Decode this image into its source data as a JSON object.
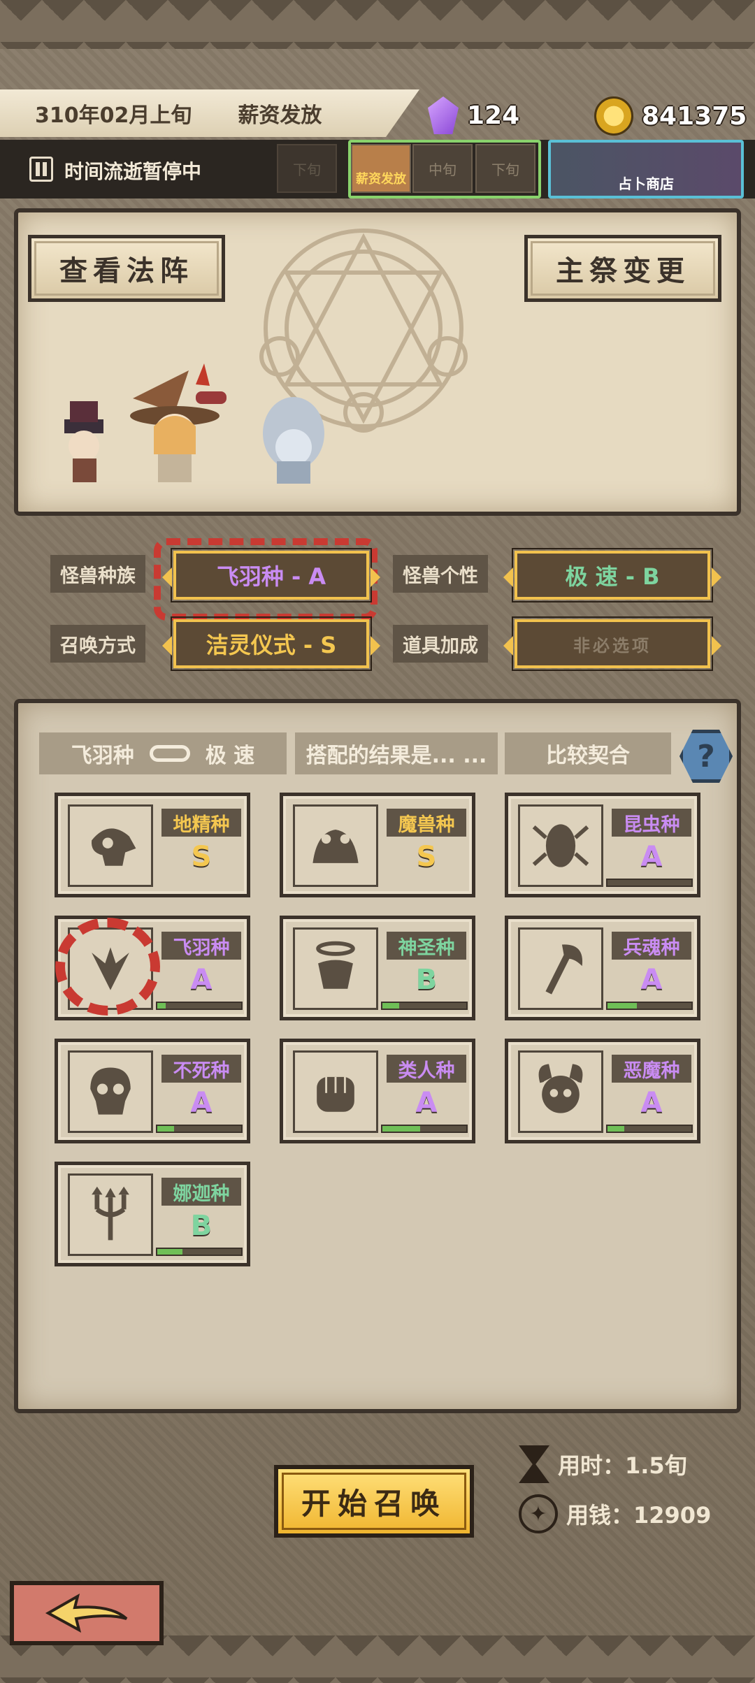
{
  "header": {
    "date": "310年02月上旬",
    "event": "薪资发放",
    "crystals": "124",
    "gold": "841375"
  },
  "timeline": {
    "status_label": "时间流逝暂停中",
    "periods_left": [
      "下旬"
    ],
    "active_period": "薪资发放",
    "periods_right": [
      "中旬",
      "下旬"
    ],
    "shop_label": "占卜商店"
  },
  "altar": {
    "view_formation": "查看法阵",
    "change_priest": "主祭变更"
  },
  "config": {
    "race_label": "怪兽种族",
    "race_value": "飞羽种 - A",
    "trait_label": "怪兽个性",
    "trait_value": "极  速 - B",
    "method_label": "召唤方式",
    "method_value": "洁灵仪式 - S",
    "item_label": "道具加成",
    "item_value": "非必选项"
  },
  "compat": {
    "race": "飞羽种",
    "trait": "极 速",
    "question": "搭配的结果是... ...",
    "result": "比较契合",
    "help": "?"
  },
  "races": [
    {
      "name": "地精种",
      "grade": "S",
      "name_color": "#f4c750",
      "grade_color": "#f4c750",
      "progress": 0,
      "icon": "goblin-skull-icon"
    },
    {
      "name": "魔兽种",
      "grade": "S",
      "name_color": "#f4c750",
      "grade_color": "#f4c750",
      "progress": 0,
      "icon": "beast-frog-icon"
    },
    {
      "name": "昆虫种",
      "grade": "A",
      "name_color": "#c98cf2",
      "grade_color": "#c98cf2",
      "progress": 0,
      "icon": "insect-icon"
    },
    {
      "name": "飞羽种",
      "grade": "A",
      "name_color": "#c98cf2",
      "grade_color": "#c98cf2",
      "progress": 0.1,
      "icon": "wing-icon",
      "selected": true
    },
    {
      "name": "神圣种",
      "grade": "B",
      "name_color": "#7ed49f",
      "grade_color": "#7ed49f",
      "progress": 0.2,
      "icon": "halo-icon"
    },
    {
      "name": "兵魂种",
      "grade": "A",
      "name_color": "#c98cf2",
      "grade_color": "#c98cf2",
      "progress": 0.35,
      "icon": "axe-icon"
    },
    {
      "name": "不死种",
      "grade": "A",
      "name_color": "#c98cf2",
      "grade_color": "#c98cf2",
      "progress": 0.2,
      "icon": "undead-skull-icon"
    },
    {
      "name": "类人种",
      "grade": "A",
      "name_color": "#c98cf2",
      "grade_color": "#c98cf2",
      "progress": 0.45,
      "icon": "fist-icon"
    },
    {
      "name": "恶魔种",
      "grade": "A",
      "name_color": "#c98cf2",
      "grade_color": "#c98cf2",
      "progress": 0.2,
      "icon": "demon-icon"
    },
    {
      "name": "娜迦种",
      "grade": "B",
      "name_color": "#7ed49f",
      "grade_color": "#7ed49f",
      "progress": 0.3,
      "icon": "trident-icon"
    }
  ],
  "footer": {
    "summon_label": "开始召唤",
    "time_cost": "用时：1.5旬",
    "money_cost": "用钱：12909"
  }
}
